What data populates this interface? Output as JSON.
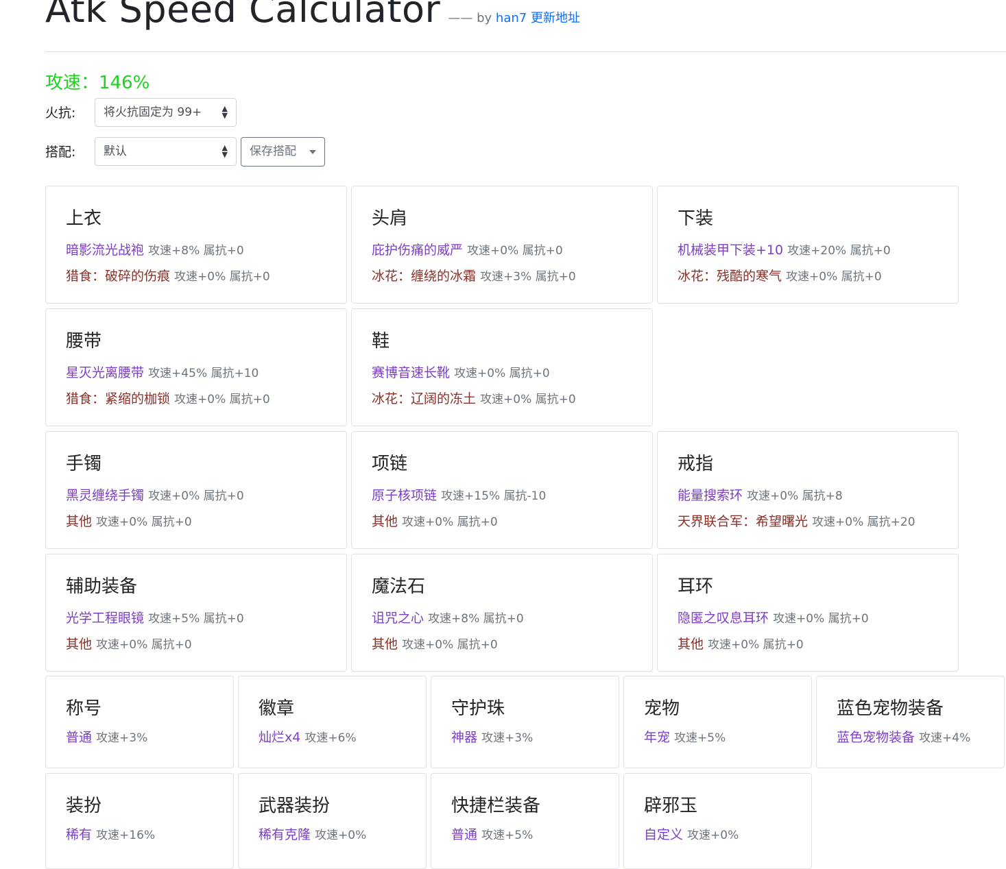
{
  "header": {
    "title": "Atk Speed Calculator",
    "byline_prefix": "—— by",
    "author": "han7",
    "update_link": "更新地址"
  },
  "speed_label": "攻速：146%",
  "fire": {
    "label": "火抗:",
    "value": "将火抗固定为 99+"
  },
  "preset": {
    "label": "搭配:",
    "value": "默认",
    "save_button": "保存搭配"
  },
  "cards": [
    {
      "title": "上衣",
      "l1": {
        "name": "暗影流光战袍",
        "stat": "攻速+8% 属抗+0"
      },
      "l2": {
        "name": "猎食：破碎的伤痕",
        "stat": "攻速+0% 属抗+0"
      }
    },
    {
      "title": "头肩",
      "l1": {
        "name": "庇护伤痛的威严",
        "stat": "攻速+0% 属抗+0"
      },
      "l2": {
        "name": "冰花：缠绕的冰霜",
        "stat": "攻速+3% 属抗+0"
      }
    },
    {
      "title": "下装",
      "l1": {
        "name": "机械装甲下装+10",
        "stat": "攻速+20% 属抗+0"
      },
      "l2": {
        "name": "冰花：残酷的寒气",
        "stat": "攻速+0% 属抗+0"
      }
    },
    {
      "title": "腰带",
      "l1": {
        "name": "星灭光离腰带",
        "stat": "攻速+45% 属抗+10"
      },
      "l2": {
        "name": "猎食：紧缩的枷锁",
        "stat": "攻速+0% 属抗+0"
      }
    },
    {
      "title": "鞋",
      "l1": {
        "name": "赛博音速长靴",
        "stat": "攻速+0% 属抗+0"
      },
      "l2": {
        "name": "冰花：辽阔的冻土",
        "stat": "攻速+0% 属抗+0"
      }
    },
    {
      "title": "手镯",
      "l1": {
        "name": "黑灵缠绕手镯",
        "stat": "攻速+0% 属抗+0"
      },
      "l2": {
        "name": "其他",
        "stat": "攻速+0% 属抗+0"
      }
    },
    {
      "title": "项链",
      "l1": {
        "name": "原子核项链",
        "stat": "攻速+15% 属抗-10"
      },
      "l2": {
        "name": "其他",
        "stat": "攻速+0% 属抗+0"
      }
    },
    {
      "title": "戒指",
      "l1": {
        "name": "能量搜索环",
        "stat": "攻速+0% 属抗+8"
      },
      "l2": {
        "name": "天界联合军：希望曙光",
        "stat": "攻速+0% 属抗+20"
      }
    },
    {
      "title": "辅助装备",
      "l1": {
        "name": "光学工程眼镜",
        "stat": "攻速+5% 属抗+0"
      },
      "l2": {
        "name": "其他",
        "stat": "攻速+0% 属抗+0"
      }
    },
    {
      "title": "魔法石",
      "l1": {
        "name": "诅咒之心",
        "stat": "攻速+8% 属抗+0"
      },
      "l2": {
        "name": "其他",
        "stat": "攻速+0% 属抗+0"
      }
    },
    {
      "title": "耳环",
      "l1": {
        "name": "隐匿之叹息耳环",
        "stat": "攻速+0% 属抗+0"
      },
      "l2": {
        "name": "其他",
        "stat": "攻速+0% 属抗+0"
      }
    },
    {
      "title": "称号",
      "l1": {
        "name": "普通",
        "stat": "攻速+3%"
      }
    },
    {
      "title": "徽章",
      "l1": {
        "name": "灿烂x4",
        "stat": "攻速+6%"
      }
    },
    {
      "title": "守护珠",
      "l1": {
        "name": "神器",
        "stat": "攻速+3%"
      }
    },
    {
      "title": "宠物",
      "l1": {
        "name": "年宠",
        "stat": "攻速+5%"
      }
    },
    {
      "title": "蓝色宠物装备",
      "l1": {
        "name": "蓝色宠物装备",
        "stat": "攻速+4%"
      }
    },
    {
      "title": "装扮",
      "l1": {
        "name": "稀有",
        "stat": "攻速+16%"
      }
    },
    {
      "title": "武器装扮",
      "l1": {
        "name": "稀有克隆",
        "stat": "攻速+0%"
      }
    },
    {
      "title": "快捷栏装备",
      "l1": {
        "name": "普通",
        "stat": "攻速+5%"
      }
    },
    {
      "title": "辟邪玉",
      "l1": {
        "name": "自定义",
        "stat": "攻速+0%"
      }
    }
  ]
}
